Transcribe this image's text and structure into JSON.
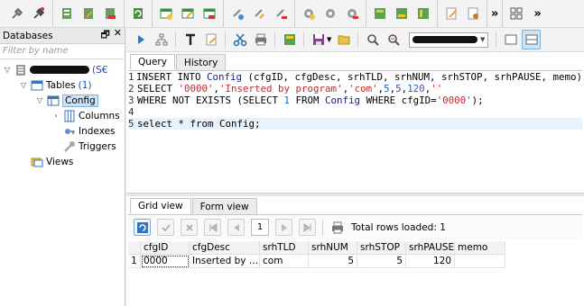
{
  "sidebar": {
    "title": "Databases",
    "ctrl_pin": "🗗",
    "ctrl_close": "✕",
    "filter_placeholder": "Filter by name",
    "db_suffix": "(S€",
    "tables_label": "Tables",
    "tables_count": "(1)",
    "table_name": "Config",
    "columns_label": "Columns",
    "indexes_label": "Indexes",
    "triggers_label": "Triggers",
    "views_label": "Views"
  },
  "toolbar": {
    "more": "»"
  },
  "editor_tabs": {
    "query": "Query",
    "history": "History"
  },
  "editor": {
    "lines": [
      {
        "n": "1",
        "t": [
          [
            "kw",
            "INSERT INTO "
          ],
          [
            "id",
            "Config"
          ],
          [
            "kw",
            " (cfgID, cfgDesc, srhTLD, srhNUM, srhSTOP, srhPAUSE, memo)"
          ]
        ]
      },
      {
        "n": "2",
        "t": [
          [
            "kw",
            "SELECT "
          ],
          [
            "str",
            "'0000'"
          ],
          [
            "kw",
            ","
          ],
          [
            "str",
            "'Inserted by program'"
          ],
          [
            "kw",
            ","
          ],
          [
            "str",
            "'com'"
          ],
          [
            "kw",
            ","
          ],
          [
            "num",
            "5"
          ],
          [
            "kw",
            ","
          ],
          [
            "num",
            "5"
          ],
          [
            "kw",
            ","
          ],
          [
            "num",
            "120"
          ],
          [
            "kw",
            ","
          ],
          [
            "str",
            "''"
          ]
        ]
      },
      {
        "n": "3",
        "t": [
          [
            "kw",
            "WHERE NOT EXISTS (SELECT "
          ],
          [
            "num",
            "1"
          ],
          [
            "kw",
            " FROM "
          ],
          [
            "id",
            "Config"
          ],
          [
            "kw",
            " WHERE cfgID="
          ],
          [
            "str",
            "'0000'"
          ],
          [
            "kw",
            ");"
          ]
        ]
      },
      {
        "n": "4",
        "t": []
      },
      {
        "n": "5",
        "t": [
          [
            "kw",
            "select * from Config;"
          ]
        ]
      }
    ]
  },
  "result_tabs": {
    "grid": "Grid view",
    "form": "Form view"
  },
  "result_toolbar": {
    "page": "1",
    "rows_loaded": "Total rows loaded: 1"
  },
  "grid": {
    "columns": [
      "cfgID",
      "cfgDesc",
      "srhTLD",
      "srhNUM",
      "srhSTOP",
      "srhPAUSE",
      "memo"
    ],
    "rows": [
      {
        "num": "1",
        "cells": [
          "0000",
          "Inserted by …",
          "com",
          "5",
          "5",
          "120",
          ""
        ]
      }
    ]
  },
  "colors": {
    "selection_bg": "#cde4f7",
    "current_line_bg": "#e8f2fb",
    "string": "#c62828",
    "number": "#1e63c4"
  }
}
